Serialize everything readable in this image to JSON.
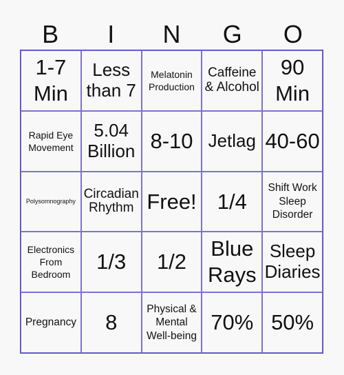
{
  "header": {
    "letters": [
      "B",
      "I",
      "N",
      "G",
      "O"
    ]
  },
  "board": {
    "cells": [
      "1-7 Min",
      "Less than 7",
      "Melatonin Production",
      "Caffeine & Alcohol",
      "90 Min",
      "Rapid Eye Movement",
      "5.04 Billion",
      "8-10",
      "Jetlag",
      "40-60",
      "Polysomnography",
      "Circadian Rhythm",
      "Free!",
      "1/4",
      "Shift Work Sleep Disorder",
      "Electronics From Bedroom",
      "1/3",
      "1/2",
      "Blue Rays",
      "Sleep Diaries",
      "Pregnancy",
      "8",
      "Physical & Mental Well-being",
      "70%",
      "50%"
    ]
  },
  "colors": {
    "grid_line": "#7a72d1",
    "background": "#f8f8f8"
  }
}
